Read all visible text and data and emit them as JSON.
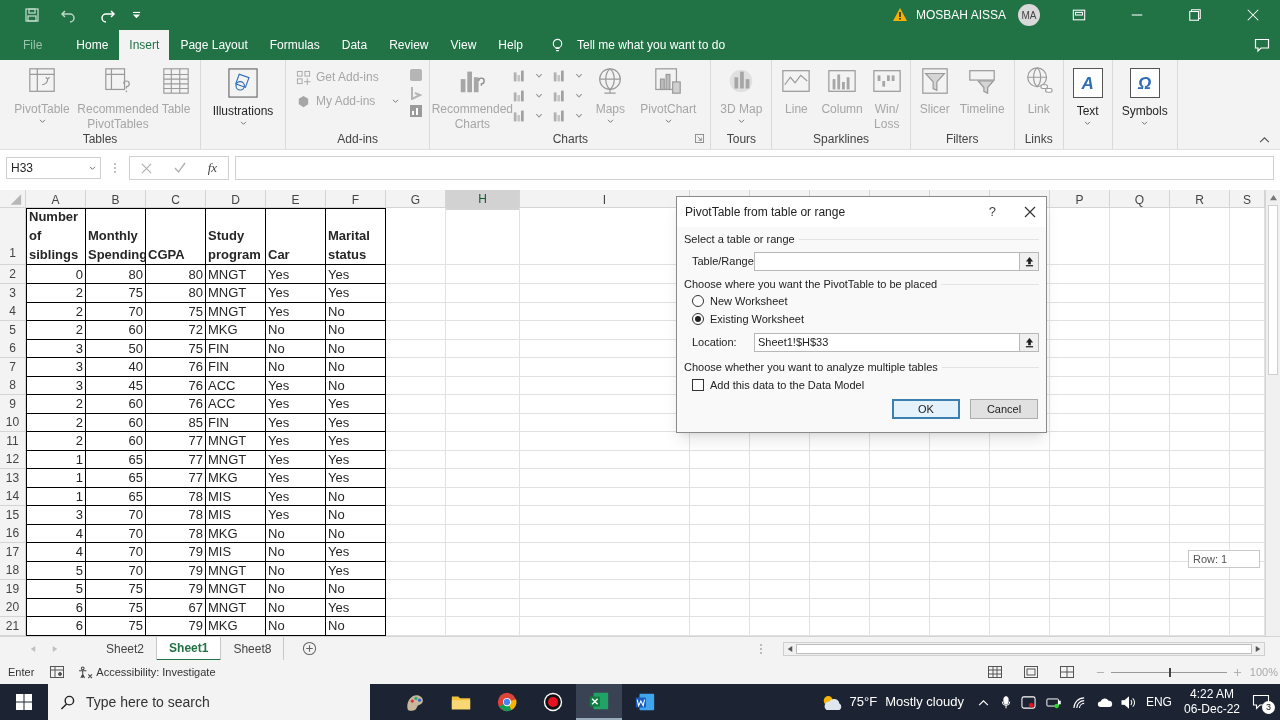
{
  "title_bar": {
    "user_name": "MOSBAH AISSA",
    "avatar": "MA"
  },
  "menu_tabs": [
    {
      "label": "File",
      "selected": false
    },
    {
      "label": "Home",
      "selected": false
    },
    {
      "label": "Insert",
      "selected": true
    },
    {
      "label": "Page Layout",
      "selected": false
    },
    {
      "label": "Formulas",
      "selected": false
    },
    {
      "label": "Data",
      "selected": false
    },
    {
      "label": "Review",
      "selected": false
    },
    {
      "label": "View",
      "selected": false
    },
    {
      "label": "Help",
      "selected": false
    }
  ],
  "tell_me": "Tell me what you want to do",
  "ribbon_groups": [
    {
      "label": "Tables",
      "items": [
        {
          "label": "PivotTable",
          "disabled": true,
          "menu": true
        },
        {
          "label": "Recommended PivotTables",
          "disabled": true,
          "menu": false
        },
        {
          "label": "Table",
          "disabled": true,
          "menu": false
        }
      ]
    },
    {
      "items": [
        {
          "label": "Illustrations",
          "disabled": false,
          "menu": true
        }
      ]
    },
    {
      "label": "Add-ins",
      "items": [
        {
          "label": "Get Add-ins",
          "disabled": true,
          "menu": false
        },
        {
          "label": "My Add-ins",
          "disabled": true,
          "menu": true
        }
      ]
    },
    {
      "label": "Charts",
      "items": [
        {
          "label": "Recommended Charts",
          "disabled": true,
          "menu": false
        },
        {
          "label": "Maps",
          "disabled": true,
          "menu": true
        },
        {
          "label": "PivotChart",
          "disabled": true,
          "menu": true
        }
      ]
    },
    {
      "label": "Tours",
      "items": [
        {
          "label": "3D Map",
          "disabled": true,
          "menu": true
        }
      ]
    },
    {
      "label": "Sparklines",
      "items": [
        {
          "label": "Line",
          "disabled": true,
          "menu": false
        },
        {
          "label": "Column",
          "disabled": true,
          "menu": false
        },
        {
          "label": "Win/ Loss",
          "disabled": true,
          "menu": false
        }
      ]
    },
    {
      "label": "Filters",
      "items": [
        {
          "label": "Slicer",
          "disabled": true,
          "menu": false
        },
        {
          "label": "Timeline",
          "disabled": true,
          "menu": false
        }
      ]
    },
    {
      "label": "Links",
      "items": [
        {
          "label": "Link",
          "disabled": true,
          "menu": false
        }
      ]
    },
    {
      "items": [
        {
          "label": "Text",
          "glyph": "A",
          "disabled": false,
          "menu": true
        }
      ]
    },
    {
      "items": [
        {
          "label": "Symbols",
          "glyph": "Ω",
          "disabled": false,
          "menu": true
        }
      ]
    }
  ],
  "formula_bar": {
    "name_box": "H33",
    "function_label": "fx"
  },
  "columns": [
    {
      "label": "A",
      "selected": false
    },
    {
      "label": "B",
      "selected": false
    },
    {
      "label": "C",
      "selected": false
    },
    {
      "label": "D",
      "selected": false
    },
    {
      "label": "E",
      "selected": false
    },
    {
      "label": "F",
      "selected": false
    },
    {
      "label": "G",
      "selected": false
    },
    {
      "label": "H",
      "selected": true
    },
    {
      "label": "I",
      "selected": false
    },
    {
      "label": "P",
      "selected": false
    },
    {
      "label": "Q",
      "selected": false
    },
    {
      "label": "R",
      "selected": false
    },
    {
      "label": "S",
      "selected": false
    }
  ],
  "rows": [
    {
      "number": "1",
      "cells": [
        "Number of siblings",
        "Monthly Spending",
        "CGPA",
        "Study program",
        "Car",
        "Marital status"
      ]
    },
    {
      "number": "2",
      "cells": [
        "0",
        "80",
        "80",
        "MNGT",
        "Yes",
        "Yes"
      ]
    },
    {
      "number": "3",
      "cells": [
        "2",
        "75",
        "80",
        "MNGT",
        "Yes",
        "Yes"
      ]
    },
    {
      "number": "4",
      "cells": [
        "2",
        "70",
        "75",
        "MNGT",
        "Yes",
        "No"
      ]
    },
    {
      "number": "5",
      "cells": [
        "2",
        "60",
        "72",
        "MKG",
        "No",
        "No"
      ]
    },
    {
      "number": "6",
      "cells": [
        "3",
        "50",
        "75",
        "FIN",
        "No",
        "No"
      ]
    },
    {
      "number": "7",
      "cells": [
        "3",
        "40",
        "76",
        "FIN",
        "No",
        "No"
      ]
    },
    {
      "number": "8",
      "cells": [
        "3",
        "45",
        "76",
        "ACC",
        "Yes",
        "No"
      ]
    },
    {
      "number": "9",
      "cells": [
        "2",
        "60",
        "76",
        "ACC",
        "Yes",
        "Yes"
      ]
    },
    {
      "number": "10",
      "cells": [
        "2",
        "60",
        "85",
        "FIN",
        "Yes",
        "Yes"
      ]
    },
    {
      "number": "11",
      "cells": [
        "2",
        "60",
        "77",
        "MNGT",
        "Yes",
        "Yes"
      ]
    },
    {
      "number": "12",
      "cells": [
        "1",
        "65",
        "77",
        "MNGT",
        "Yes",
        "Yes"
      ]
    },
    {
      "number": "13",
      "cells": [
        "1",
        "65",
        "77",
        "MKG",
        "Yes",
        "Yes"
      ]
    },
    {
      "number": "14",
      "cells": [
        "1",
        "65",
        "78",
        "MIS",
        "Yes",
        "No"
      ]
    },
    {
      "number": "15",
      "cells": [
        "3",
        "70",
        "78",
        "MIS",
        "Yes",
        "No"
      ]
    },
    {
      "number": "16",
      "cells": [
        "4",
        "70",
        "78",
        "MKG",
        "No",
        "No"
      ]
    },
    {
      "number": "17",
      "cells": [
        "4",
        "70",
        "79",
        "MIS",
        "No",
        "Yes"
      ]
    },
    {
      "number": "18",
      "cells": [
        "5",
        "70",
        "79",
        "MNGT",
        "No",
        "Yes"
      ]
    },
    {
      "number": "19",
      "cells": [
        "5",
        "75",
        "79",
        "MNGT",
        "No",
        "No"
      ]
    },
    {
      "number": "20",
      "cells": [
        "6",
        "75",
        "67",
        "MNGT",
        "No",
        "Yes"
      ]
    },
    {
      "number": "21",
      "cells": [
        "6",
        "75",
        "79",
        "MKG",
        "No",
        "No"
      ]
    }
  ],
  "row_tooltip": "Row: 1",
  "dialog": {
    "title": "PivotTable from table or range",
    "help": "?",
    "section_source": "Select a table or range",
    "range_label": "Table/Range:",
    "section_place": "Choose where you want the PivotTable to be placed",
    "placements": [
      {
        "label": "New Worksheet",
        "selected": false
      },
      {
        "label": "Existing Worksheet",
        "selected": true
      }
    ],
    "location_label": "Location:",
    "location_value": "Sheet1!$H$33",
    "section_multi": "Choose whether you want to analyze multiple tables",
    "data_model": {
      "label": "Add this data to the Data Model",
      "checked": false
    },
    "buttons": [
      {
        "label": "OK",
        "default": true
      },
      {
        "label": "Cancel",
        "default": false
      }
    ]
  },
  "sheet_tabs": [
    {
      "label": "Sheet2",
      "selected": false
    },
    {
      "label": "Sheet1",
      "selected": true
    },
    {
      "label": "Sheet8",
      "selected": false
    }
  ],
  "status_bar": {
    "mode": "Enter",
    "accessibility": "Accessibility: Investigate",
    "zoom": "100%",
    "zoom_slider": {
      "level": 0.5
    }
  },
  "taskbar": {
    "search_placeholder": "Type here to search",
    "temperature": "75°F",
    "weather": "Mostly cloudy",
    "language": "ENG",
    "time": "4:22 AM",
    "date": "06-Dec-22",
    "notifications": "3"
  }
}
